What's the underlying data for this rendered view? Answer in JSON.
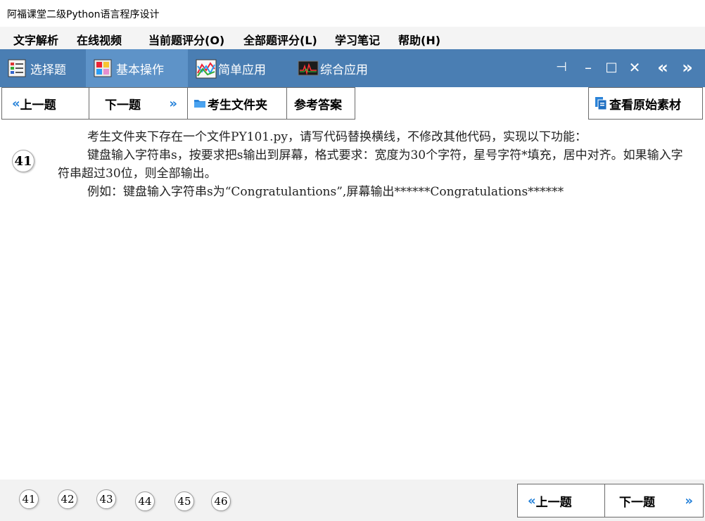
{
  "window": {
    "title": "阿福课堂二级Python语言程序设计"
  },
  "menu": {
    "items": [
      "文字解析",
      "在线视频",
      "当前题评分(O)",
      "全部题评分(L)",
      "学习笔记",
      "帮助(H)"
    ]
  },
  "tabs": [
    {
      "label": "选择题",
      "icon": "choice-icon"
    },
    {
      "label": "基本操作",
      "icon": "basic-op-icon"
    },
    {
      "label": "简单应用",
      "icon": "chart-icon"
    },
    {
      "label": "综合应用",
      "icon": "monitor-icon"
    }
  ],
  "window_controls": [
    "pin-icon",
    "minimize-icon",
    "maximize-icon",
    "close-icon",
    "prev-page-icon",
    "next-page-icon"
  ],
  "toolbar": {
    "prev_label": "上一题",
    "next_label": "下一题",
    "folder_label": "考生文件夹",
    "answer_label": "参考答案",
    "source_label": "查看原始素材"
  },
  "question": {
    "number": "41",
    "lines": [
      "考生文件夹下存在一个文件PY101.py，请写代码替换横线，不修改其他代码，实现以下功能：",
      "键盘输入字符串s，按要求把s输出到屏幕，格式要求：宽度为30个字符，星号字符*填充，居中对齐。如果输入字符串超过30位，则全部输出。",
      "例如：键盘输入字符串s为“Congratulantions”,屏幕输出******Congratulations******"
    ]
  },
  "pager": {
    "numbers": [
      "41",
      "42",
      "43",
      "44",
      "45",
      "46"
    ],
    "prev_label": "上一题",
    "next_label": "下一题"
  },
  "colors": {
    "ribbon": "#4a7eb3",
    "active_tab": "#5e93c8",
    "chevron": "#1f7ed8"
  }
}
